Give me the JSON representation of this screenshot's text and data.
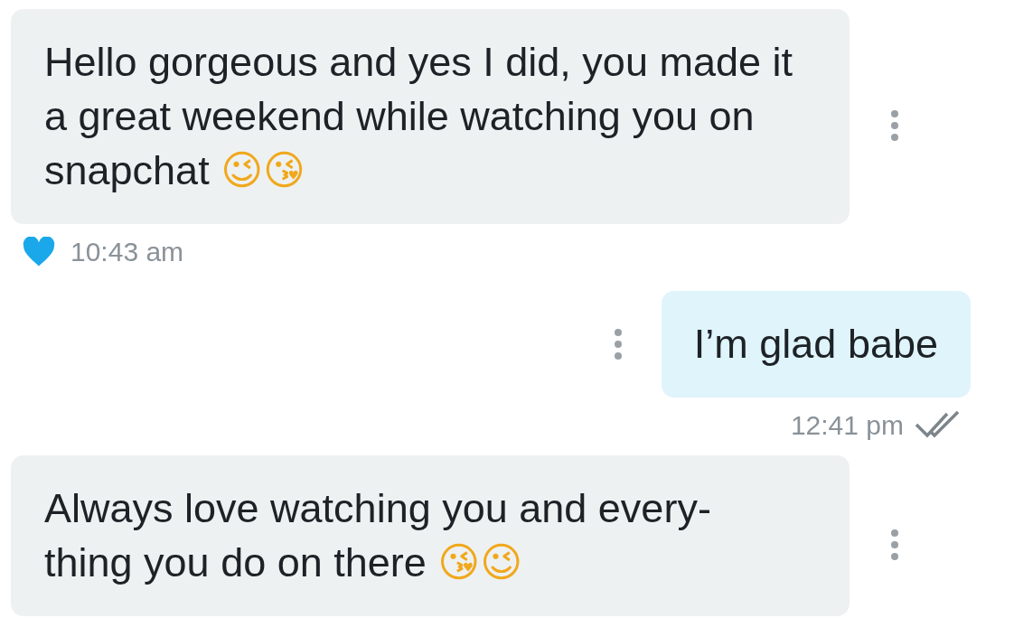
{
  "messages": [
    {
      "kind": "incoming",
      "text": "Hello gorgeous and yes I did, you made it a great weekend while watching you on snapchat 😉😘",
      "liked": true,
      "time": "10:43 am"
    },
    {
      "kind": "outgoing",
      "text": "I’m glad babe",
      "time": "12:41 pm",
      "read": true
    },
    {
      "kind": "incoming",
      "text": "Always love watching you and every-thing you do on there 😘😉"
    }
  ]
}
